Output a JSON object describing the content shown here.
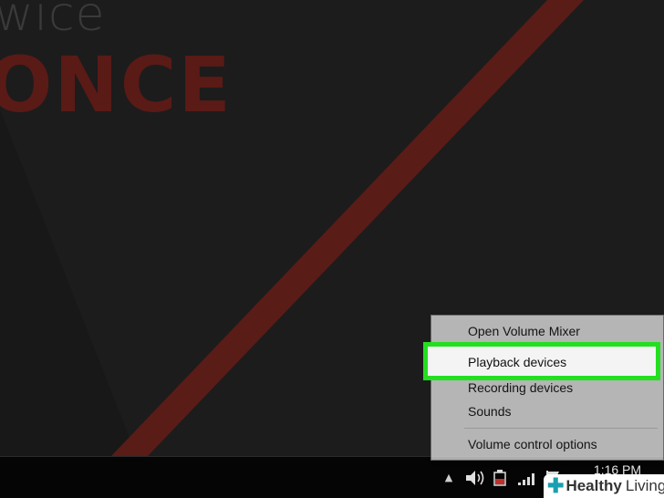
{
  "wallpaper": {
    "small_text": "wice",
    "big_text": "ONCE",
    "stripe_color": "#5a1c17"
  },
  "context_menu": {
    "items": [
      {
        "label": "Open Volume Mixer"
      },
      {
        "label": "Playback devices",
        "highlighted": true
      },
      {
        "label": "Recording devices"
      },
      {
        "label": "Sounds"
      },
      {
        "label": "Volume control options"
      }
    ],
    "highlight_color": "#22e01f"
  },
  "taskbar": {
    "clock": "1:16 PM",
    "tray_icons": [
      "show-hidden-icons-arrow",
      "speaker-icon",
      "power-icon",
      "network-signal-icon",
      "action-center-flag-icon"
    ]
  },
  "watermark": {
    "strong": "Healthy",
    "light": "Living"
  }
}
